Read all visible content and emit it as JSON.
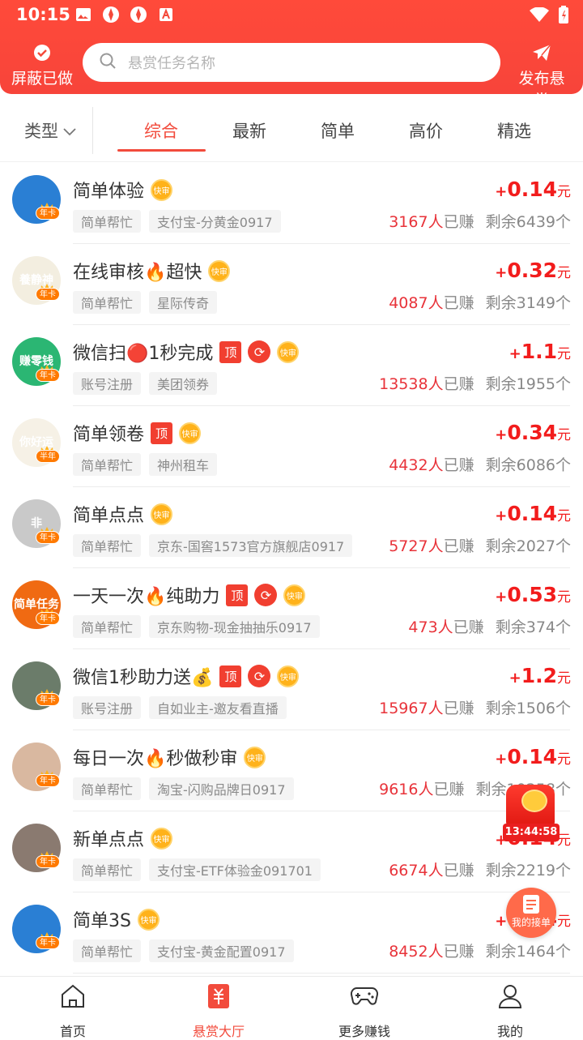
{
  "status_bar": {
    "time": "10:15"
  },
  "header": {
    "block_done_label": "屏蔽已做",
    "search_placeholder": "悬赏任务名称",
    "publish_label": "发布悬赏"
  },
  "tabs": {
    "type_label": "类型",
    "items": [
      "综合",
      "最新",
      "简单",
      "高价",
      "精选"
    ],
    "active_index": 0
  },
  "badges": {
    "fast": "快审",
    "top": "顶",
    "year": "年卡",
    "half_year": "半年"
  },
  "tasks": [
    {
      "title": "简单体验",
      "top": false,
      "refresh": false,
      "tags": [
        "简单帮忙",
        "支付宝-分黄金0917"
      ],
      "plus": "+",
      "reward": "0.14",
      "unit": "元",
      "earned": "3167人",
      "earned_suffix": "已赚",
      "remaining": "剩余6439个",
      "avatar_color": "#2a7fd4",
      "avatar_text": "",
      "badge": "年卡"
    },
    {
      "title": "在线审核🔥超快",
      "top": false,
      "refresh": false,
      "tags": [
        "简单帮忙",
        "星际传奇"
      ],
      "plus": "+",
      "reward": "0.32",
      "unit": "元",
      "earned": "4087人",
      "earned_suffix": "已赚",
      "remaining": "剩余3149个",
      "avatar_color": "#f3eee0",
      "avatar_text": "養静神",
      "badge": "年卡"
    },
    {
      "title": "微信扫🔴1秒完成",
      "top": true,
      "refresh": true,
      "tags": [
        "账号注册",
        "美团领券"
      ],
      "plus": "+",
      "reward": "1.1",
      "unit": "元",
      "earned": "13538人",
      "earned_suffix": "已赚",
      "remaining": "剩余1955个",
      "avatar_color": "#2bb673",
      "avatar_text": "赚零钱",
      "badge": "年卡"
    },
    {
      "title": "简单领卷",
      "top": true,
      "refresh": false,
      "tags": [
        "简单帮忙",
        "神州租车"
      ],
      "plus": "+",
      "reward": "0.34",
      "unit": "元",
      "earned": "4432人",
      "earned_suffix": "已赚",
      "remaining": "剩余6086个",
      "avatar_color": "#f6f1e6",
      "avatar_text": "你好运",
      "badge": "半年"
    },
    {
      "title": "简单点点",
      "top": false,
      "refresh": false,
      "tags": [
        "简单帮忙",
        "京东-国窖1573官方旗舰店0917"
      ],
      "plus": "+",
      "reward": "0.14",
      "unit": "元",
      "earned": "5727人",
      "earned_suffix": "已赚",
      "remaining": "剩余2027个",
      "avatar_color": "#c9c9c9",
      "avatar_text": "非",
      "badge": "年卡"
    },
    {
      "title": "一天一次🔥纯助力",
      "top": true,
      "refresh": true,
      "tags": [
        "简单帮忙",
        "京东购物-现金抽抽乐0917"
      ],
      "plus": "+",
      "reward": "0.53",
      "unit": "元",
      "earned": "473人",
      "earned_suffix": "已赚",
      "remaining": "剩余374个",
      "avatar_color": "#f06a12",
      "avatar_text": "简单任务",
      "badge": "年卡"
    },
    {
      "title": "微信1秒助力送💰",
      "top": true,
      "refresh": true,
      "tags": [
        "账号注册",
        "自如业主-邀友看直播"
      ],
      "plus": "+",
      "reward": "1.2",
      "unit": "元",
      "earned": "15967人",
      "earned_suffix": "已赚",
      "remaining": "剩余1506个",
      "avatar_color": "#6b7c6a",
      "avatar_text": "",
      "badge": "年卡"
    },
    {
      "title": "每日一次🔥秒做秒审",
      "top": false,
      "refresh": false,
      "tags": [
        "简单帮忙",
        "淘宝-闪购品牌日0917"
      ],
      "plus": "+",
      "reward": "0.14",
      "unit": "元",
      "earned": "9616人",
      "earned_suffix": "已赚",
      "remaining": "剩余10258个",
      "avatar_color": "#d9b8a0",
      "avatar_text": "",
      "badge": "年卡"
    },
    {
      "title": "新单点点",
      "top": false,
      "refresh": false,
      "tags": [
        "简单帮忙",
        "支付宝-ETF体验金091701"
      ],
      "plus": "+",
      "reward": "0.14",
      "unit": "元",
      "earned": "6674人",
      "earned_suffix": "已赚",
      "remaining": "剩余2219个",
      "avatar_color": "#8a7a70",
      "avatar_text": "",
      "badge": "年卡"
    },
    {
      "title": "简单3S",
      "top": false,
      "refresh": false,
      "tags": [
        "简单帮忙",
        "支付宝-黄金配置0917"
      ],
      "plus": "+",
      "reward": "0.14",
      "unit": "元",
      "earned": "8452人",
      "earned_suffix": "已赚",
      "remaining": "剩余1464个",
      "avatar_color": "#2a7fd4",
      "avatar_text": "",
      "badge": "年卡"
    }
  ],
  "floating": {
    "countdown": "13:44:58",
    "my_orders_label": "我的接单"
  },
  "bottom_nav": {
    "items": [
      "首页",
      "悬赏大厅",
      "更多赚钱",
      "我的"
    ],
    "active_index": 1
  },
  "colors": {
    "brand": "#f24b3c",
    "reward": "#f21c1c",
    "fast_badge": "#ffb21a"
  }
}
